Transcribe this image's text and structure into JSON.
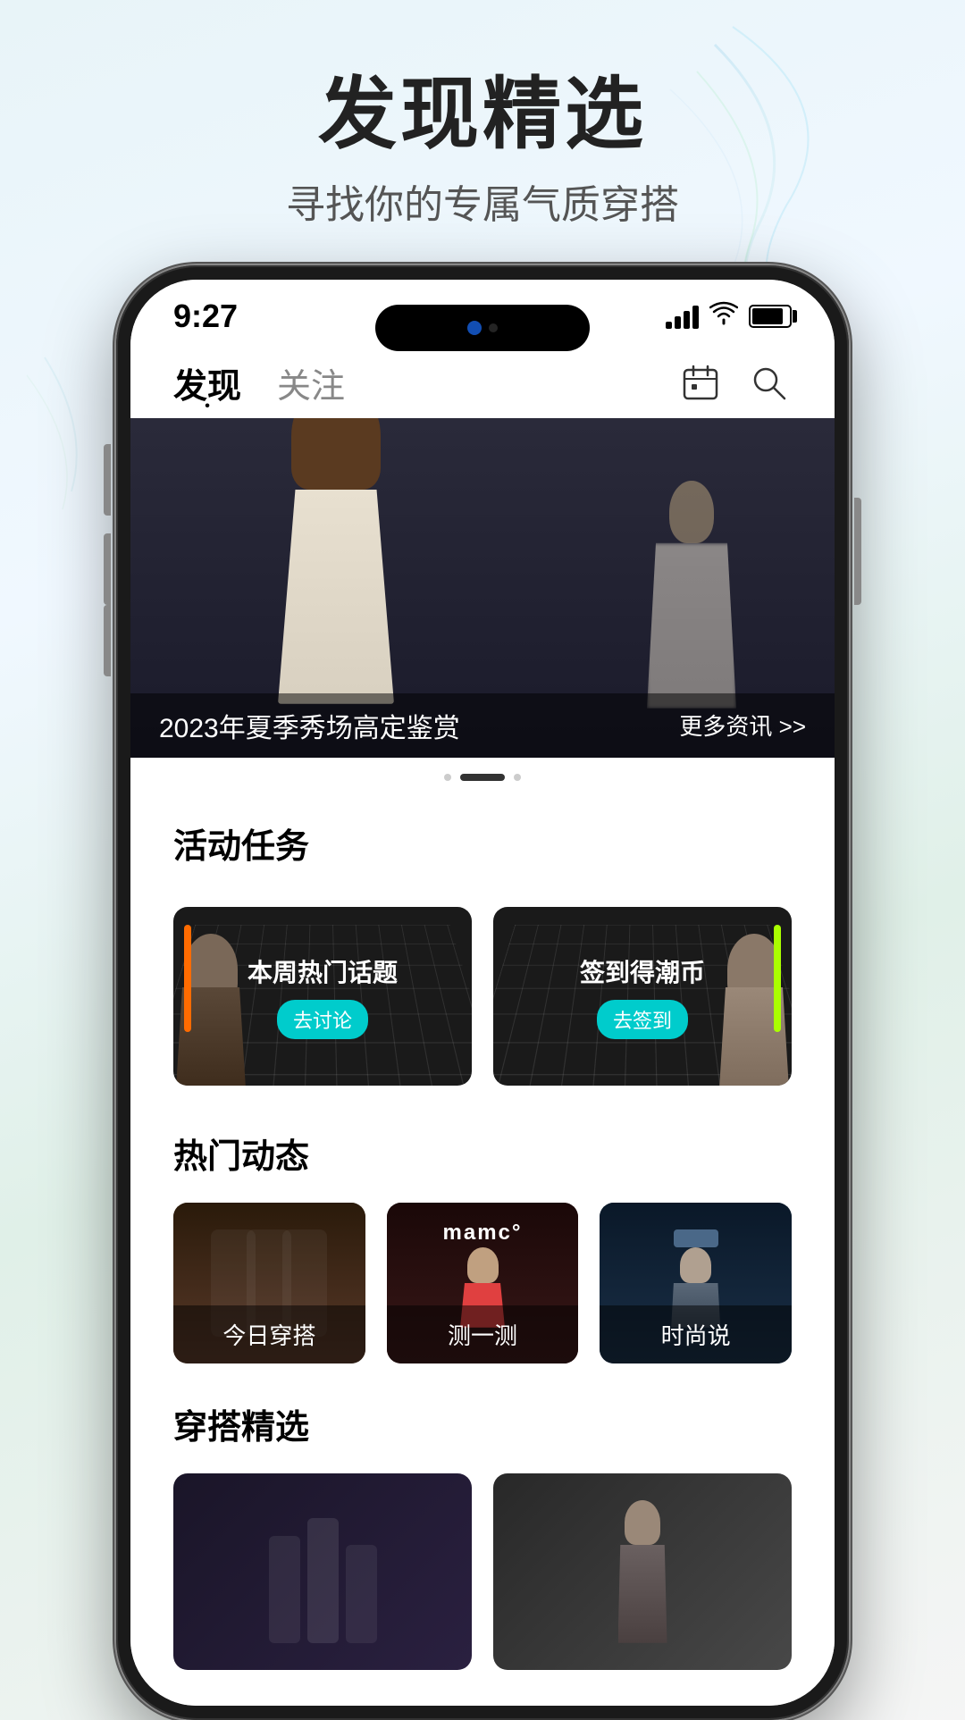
{
  "page": {
    "title": "发现精选",
    "subtitle": "寻找你的专属气质穿搭"
  },
  "status_bar": {
    "time": "9:27",
    "signal": "signal-icon",
    "wifi": "wifi-icon",
    "battery": "battery-icon"
  },
  "nav": {
    "tab1": "发现",
    "tab2": "关注",
    "calendar_icon": "calendar-icon",
    "search_icon": "search-icon"
  },
  "hero": {
    "title": "2023年夏季秀场高定鉴赏",
    "more_text": "更多资讯 >>",
    "dots": [
      "active",
      "inactive",
      "inactive"
    ]
  },
  "activity_section": {
    "title": "活动任务",
    "cards": [
      {
        "main_text": "本周热门话题",
        "badge": "去讨论"
      },
      {
        "main_text": "签到得潮币",
        "badge": "去签到"
      }
    ]
  },
  "hot_section": {
    "title": "热门动态",
    "cards": [
      {
        "label": "今日穿搭",
        "tag": ""
      },
      {
        "label": "测一测",
        "tag": "mamc°"
      },
      {
        "label": "时尚说",
        "tag": ""
      }
    ]
  },
  "outfit_section": {
    "title": "穿搭精选",
    "cards": [
      {
        "label": ""
      },
      {
        "label": ""
      }
    ]
  }
}
